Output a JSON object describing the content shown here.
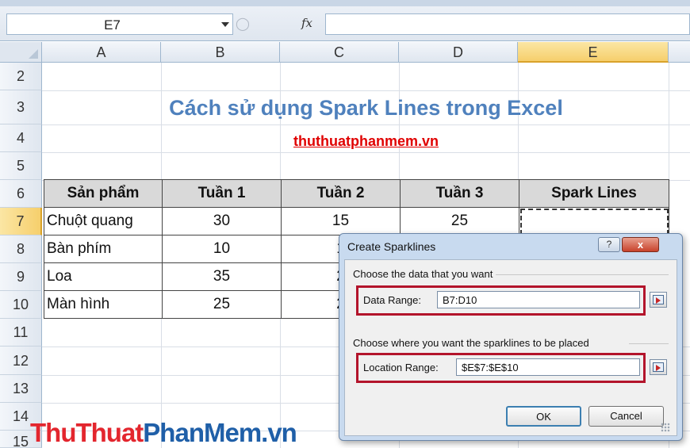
{
  "formula_bar": {
    "name_box": "E7",
    "fx_label": "fx",
    "formula": ""
  },
  "columns": [
    "A",
    "B",
    "C",
    "D",
    "E"
  ],
  "selected_column": "E",
  "rows": [
    "2",
    "3",
    "4",
    "5",
    "6",
    "7",
    "8",
    "9",
    "10",
    "11",
    "12",
    "13",
    "14",
    "15"
  ],
  "selected_row": "7",
  "sheet": {
    "title": "Cách sử dụng Spark Lines trong Excel",
    "link": "thuthuatphanmem.vn",
    "table": {
      "headers": [
        "Sản phẩm",
        "Tuần 1",
        "Tuần 2",
        "Tuần 3",
        "Spark Lines"
      ],
      "rows": [
        [
          "Chuột quang",
          "30",
          "15",
          "25",
          ""
        ],
        [
          "Bàn phím",
          "10",
          "1",
          "",
          ""
        ],
        [
          "Loa",
          "35",
          "2",
          "",
          ""
        ],
        [
          "Màn hình",
          "25",
          "2",
          "",
          ""
        ]
      ]
    }
  },
  "watermark": {
    "part1": "ThuThuat",
    "part2": "PhanMem.vn"
  },
  "dialog": {
    "title": "Create Sparklines",
    "help": "?",
    "close": "x",
    "group1_label": "Choose the data that you want",
    "data_range_label": "Data Range:",
    "data_range_value": "B7:D10",
    "group2_label": "Choose where you want the sparklines to be placed",
    "location_range_label": "Location Range:",
    "location_range_value": "$E$7:$E$10",
    "ok": "OK",
    "cancel": "Cancel"
  },
  "colors": {
    "title_blue": "#4f81bd",
    "link_red": "#e00000",
    "highlight_red": "#b3142b",
    "selected_header": "#f6cf6c"
  }
}
